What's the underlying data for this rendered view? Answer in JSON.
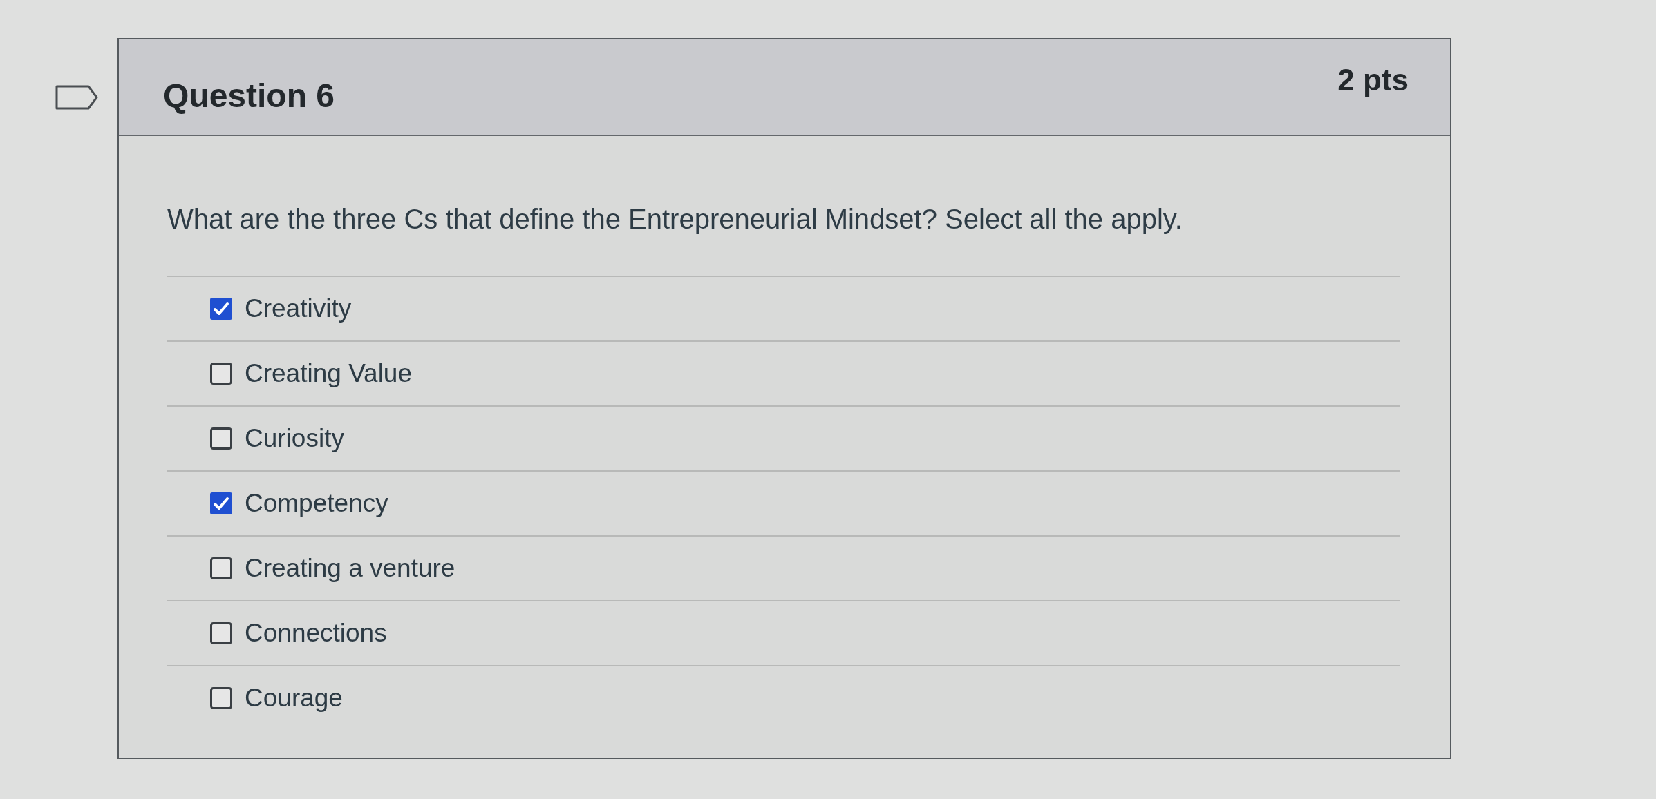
{
  "question": {
    "title": "Question 6",
    "points": "2 pts",
    "text": "What are the three Cs that define the Entrepreneurial Mindset? Select all the apply."
  },
  "options": [
    {
      "label": "Creativity",
      "checked": true
    },
    {
      "label": "Creating Value",
      "checked": false
    },
    {
      "label": "Curiosity",
      "checked": false
    },
    {
      "label": "Competency",
      "checked": true
    },
    {
      "label": "Creating a venture",
      "checked": false
    },
    {
      "label": "Connections",
      "checked": false
    },
    {
      "label": "Courage",
      "checked": false
    }
  ]
}
